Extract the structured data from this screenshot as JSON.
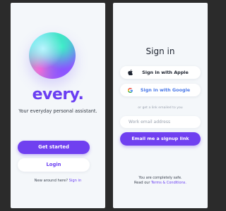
{
  "welcome": {
    "brand": "every.",
    "tagline": "Your everyday personal assistant.",
    "get_started_label": "Get started",
    "login_label": "Login",
    "new_around_prefix": "New around here? ",
    "new_around_link": "Sign in"
  },
  "signin": {
    "title": "Sign in",
    "apple_label": "Sign in with Apple",
    "google_label": "Sign in with Google",
    "divider_text": "or get a link emailed to you",
    "email_placeholder": "Work email address",
    "signup_link_label": "Email me a signup link",
    "safe_text": "You are completely safe.",
    "terms_prefix": "Read our ",
    "terms_link": "Terms & Conditions."
  },
  "colors": {
    "accent": "#7040f0",
    "brand_text": "#6a3ef2",
    "google_text": "#4a78e8",
    "screen_bg": "#f4f7fa",
    "backdrop": "#2b2b2b"
  },
  "icons": {
    "apple": "apple-icon",
    "google": "google-icon"
  }
}
